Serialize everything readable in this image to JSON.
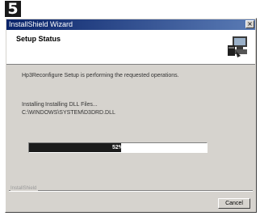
{
  "step_number": "5",
  "window": {
    "title": "InstallShield Wizard",
    "close_symbol": "×"
  },
  "header": {
    "title": "Setup Status",
    "icon": "installer-computer-icon"
  },
  "status": {
    "message": "Hp3Reconfigure Setup is performing the requested operations.",
    "action": "Installing",
    "detail": "Installing DLL Files...",
    "path": "C:\\WINDOWS\\SYSTEM\\D3DRD.DLL"
  },
  "progress": {
    "percent": 52,
    "label": "52%"
  },
  "footer": {
    "brand": "InstallShield",
    "cancel_label": "Cancel"
  },
  "colors": {
    "title_bar": "#0a246a",
    "progress_fill": "#1b1b1b",
    "dialog_face": "#d6d3ce"
  }
}
